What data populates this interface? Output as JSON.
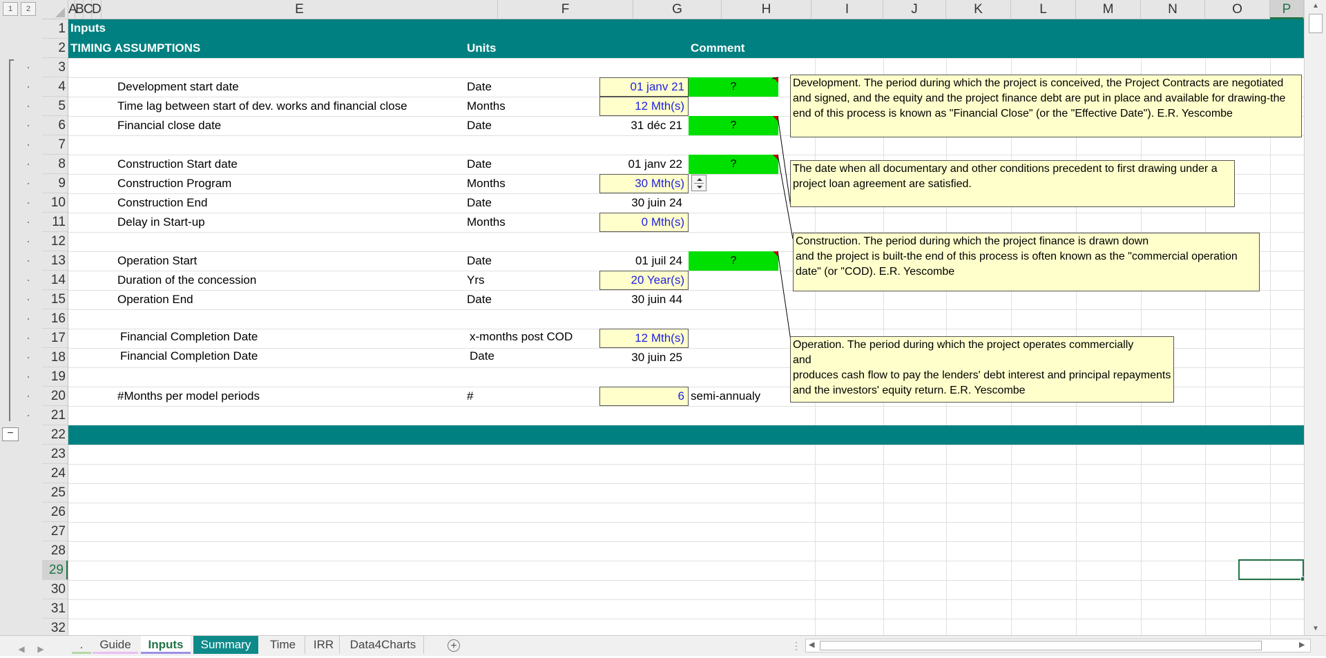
{
  "sheet": {
    "outline_levels": [
      "1",
      "2"
    ],
    "columns": [
      "A",
      "B",
      "C",
      "D",
      "E",
      "F",
      "G",
      "H",
      "I",
      "J",
      "K",
      "L",
      "M",
      "N",
      "O",
      "P"
    ],
    "rows": [
      "1",
      "2",
      "3",
      "4",
      "5",
      "6",
      "7",
      "8",
      "9",
      "10",
      "11",
      "12",
      "13",
      "14",
      "15",
      "16",
      "17",
      "18",
      "19",
      "20",
      "21",
      "22",
      "23",
      "24",
      "25",
      "26",
      "27",
      "28",
      "29",
      "30",
      "31",
      "32"
    ],
    "selected_column": "P",
    "selected_row": "29",
    "outline_collapse": "−"
  },
  "header": {
    "title": "Inputs",
    "section": "TIMING ASSUMPTIONS",
    "units_label": "Units",
    "comment_label": "Comment"
  },
  "rows": {
    "r4": {
      "label": "Development start date",
      "unit": "Date",
      "value": "01 janv 21",
      "flag": "?"
    },
    "r5": {
      "label": "Time lag between start of dev. works and financial close",
      "unit": "Months",
      "value": "12 Mth(s)"
    },
    "r6": {
      "label": "Financial close date",
      "unit": "Date",
      "value": "31 déc 21",
      "flag": "?"
    },
    "r8": {
      "label": "Construction Start date",
      "unit": "Date",
      "value": "01 janv 22",
      "flag": "?"
    },
    "r9": {
      "label": "Construction Program",
      "unit": "Months",
      "value": "30 Mth(s)"
    },
    "r10": {
      "label": "Construction End",
      "unit": "Date",
      "value": "30 juin 24"
    },
    "r11": {
      "label": "Delay in Start-up",
      "unit": "Months",
      "value": "0 Mth(s)"
    },
    "r13": {
      "label": "Operation Start",
      "unit": "Date",
      "value": "01 juil 24",
      "flag": "?"
    },
    "r14": {
      "label": "Duration of the concession",
      "unit": "Yrs",
      "value": "20 Year(s)"
    },
    "r15": {
      "label": "Operation End",
      "unit": "Date",
      "value": "30 juin 44"
    },
    "r17": {
      "label": "Financial Completion Date",
      "unit": "x-months post COD",
      "value": "12 Mth(s)"
    },
    "r18": {
      "label": "Financial Completion Date",
      "unit": "Date",
      "value": "30 juin 25"
    },
    "r20": {
      "label": "#Months per model periods",
      "unit": "#",
      "value": "6",
      "note": "semi-annualy"
    }
  },
  "comments": {
    "development": "Development. The period during which the project is conceived, the Project Contracts are negotiated and signed, and the equity and the project finance debt are put in place and available for drawing-the end of this process is known as \"Financial Close\" (or the \"Effective Date\"). E.R. Yescombe",
    "financial_close": "The date when all documentary and other conditions precedent to first drawing under a project loan agreement are satisfied.",
    "construction_1": "Construction. The period during which the project finance is drawn down",
    "construction_2": "and the project is built-the end of this process is often known as the \"commercial operation date\" (or \"COD). E.R. Yescombe",
    "operation_1": "Operation. The period during which the project operates commercially",
    "operation_2": "and",
    "operation_3": "produces cash flow to pay the lenders' debt interest and principal repayments and the investors' equity return. E.R. Yescombe"
  },
  "tabs": [
    {
      "label": ".",
      "color": "#e2efda"
    },
    {
      "label": "Guide",
      "color": "#f2dcf7"
    },
    {
      "label": "Inputs",
      "color": "#dcd6f7"
    },
    {
      "label": "Summary",
      "color": "#0f8a8a"
    },
    {
      "label": "Time",
      "color": ""
    },
    {
      "label": "IRR",
      "color": ""
    },
    {
      "label": "Data4Charts",
      "color": ""
    }
  ],
  "colors": {
    "teal_band": "#008080",
    "input_fill": "#ffffcc",
    "input_text": "#1f1fe0",
    "flag_green": "#00e000"
  }
}
